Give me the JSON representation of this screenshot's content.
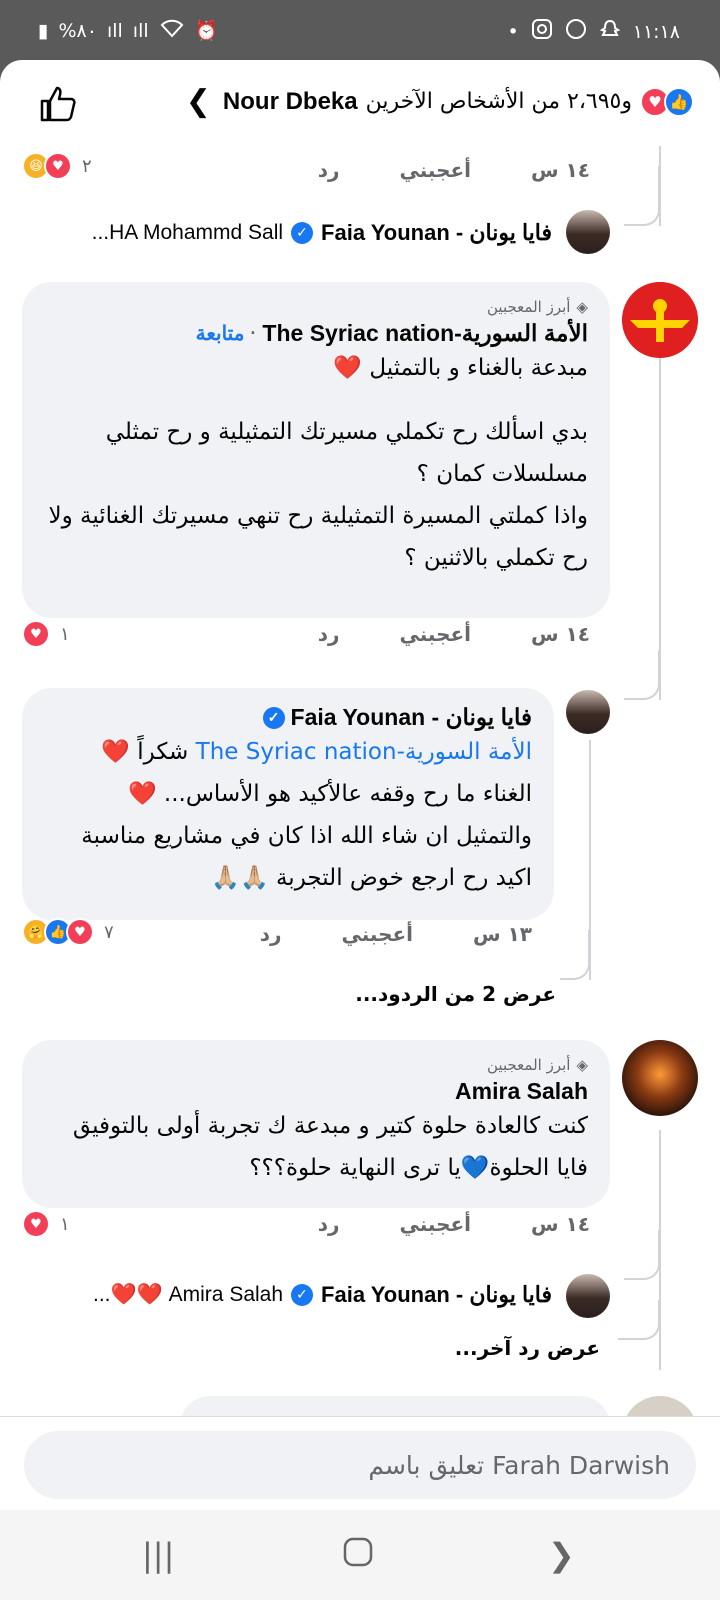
{
  "status": {
    "time": "١١:١٨",
    "battery": "%٨٠"
  },
  "header": {
    "name": "Nour Dbeka",
    "reaction_count": "و٢،٦٩٥ من الأشخاص الآخرين"
  },
  "top_snippet": {
    "time": "١٤ س",
    "like": "أعجبني",
    "reply": "رد",
    "reaction_count": "٢"
  },
  "reply_preview_1": {
    "author": "فايا يونان - Faia Younan",
    "preview": "HA Mohammd Sall..."
  },
  "comment_1": {
    "badge": "أبرز المعجبين",
    "author": "الأمة السورية-The Syriac nation",
    "follow": "متابعة",
    "text": "مبدعة بالغناء و بالتمثيل ❤️",
    "text2": "بدي اسألك رح تكملي مسيرتك التمثيلية و رح تمثلي مسلسلات كمان ؟",
    "text3": "واذا كملتي المسيرة التمثيلية رح تنهي مسيرتك الغنائية ولا رح تكملي بالاثنين ؟",
    "time": "١٤ س",
    "like": "أعجبني",
    "reply": "رد",
    "reaction_count": "١"
  },
  "reply_1": {
    "author": "فايا يونان - Faia Younan",
    "mention": "الأمة السورية-The Syriac nation",
    "text_a": "شكراً ❤️",
    "text_b": "الغناء ما رح وقفه عالأكيد هو الأساس... ❤️",
    "text_c": "والتمثيل ان شاء الله اذا كان في مشاريع مناسبة اكيد رح ارجع خوض التجربة 🙏🏼🙏🏼",
    "time": "١٣ س",
    "like": "أعجبني",
    "reply": "رد",
    "reaction_count": "٧"
  },
  "view_more_1": "عرض 2 من الردود...",
  "comment_2": {
    "badge": "أبرز المعجبين",
    "author": "Amira Salah",
    "text": "كنت كالعادة حلوة كتير و مبدعة ك تجربة أولى بالتوفيق فايا الحلوة💙يا ترى النهاية حلوة؟؟؟",
    "time": "١٤ س",
    "like": "أعجبني",
    "reply": "رد",
    "reaction_count": "١"
  },
  "reply_preview_2": {
    "author": "فايا يونان - Faia Younan",
    "preview": "Amira Salah ❤️❤️..."
  },
  "view_more_2": "عرض رد آخر...",
  "composer": {
    "placeholder": "تعليق باسم Farah Darwish"
  }
}
